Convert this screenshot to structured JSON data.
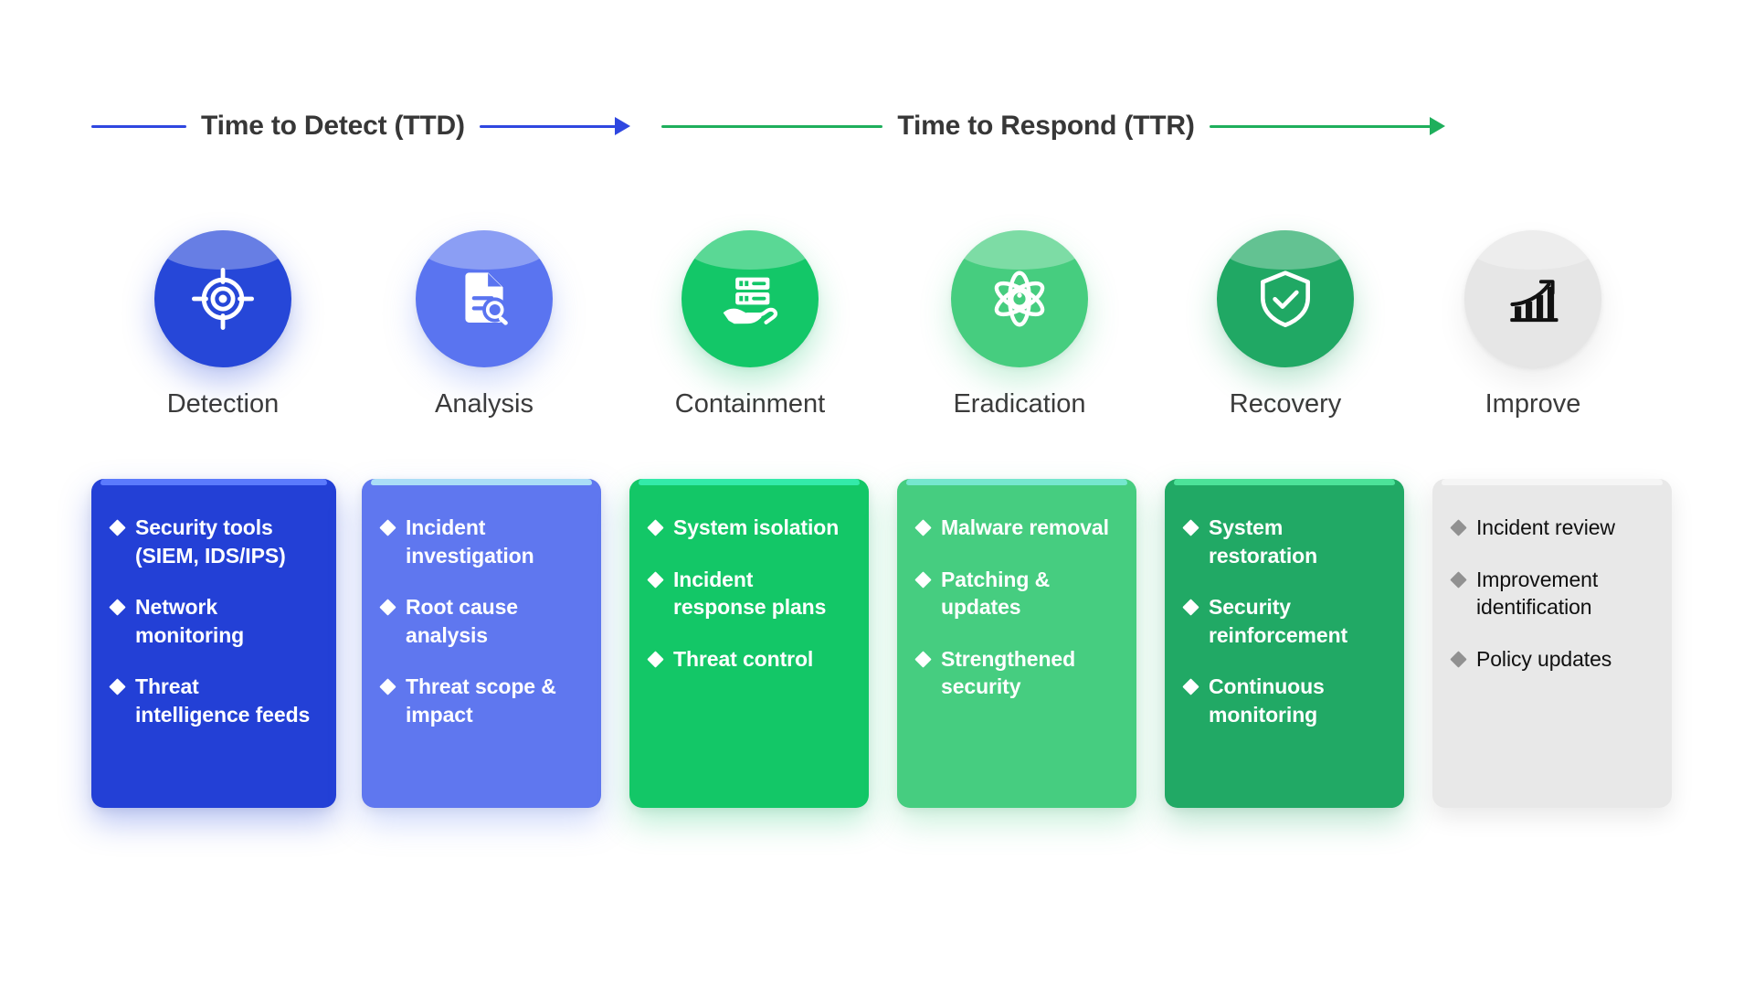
{
  "phases": [
    {
      "id": "ttd",
      "label": "Time to Detect (TTD)",
      "color": "#2f47e0"
    },
    {
      "id": "ttr",
      "label": "Time to Respond (TTR)",
      "color": "#1faf5c"
    }
  ],
  "stages": [
    {
      "key": "detection",
      "label": "Detection",
      "icon": "crosshair-target-icon",
      "circle_color": "#2647d8",
      "card_color": "#2340d6",
      "card_rim": "#5f7dff",
      "bullet_color": "#ffffff",
      "text_color": "#ffffff",
      "glow": "rgba(52,86,224,0.34)",
      "items": [
        "Security tools (SIEM, IDS/IPS)",
        "Network monitoring",
        "Threat intelligence feeds"
      ]
    },
    {
      "key": "analysis",
      "label": "Analysis",
      "icon": "document-search-icon",
      "circle_color": "#5a74f0",
      "card_color": "#5f77ef",
      "card_rim": "#aee3f7",
      "bullet_color": "#ffffff",
      "text_color": "#ffffff",
      "glow": "rgba(118,146,243,0.34)",
      "items": [
        "Incident investigation",
        "Root cause analysis",
        "Threat scope & impact"
      ]
    },
    {
      "key": "containment",
      "label": "Containment",
      "icon": "hand-server-icon",
      "circle_color": "#13c768",
      "card_color": "#13c767",
      "card_rim": "#35ecae",
      "bullet_color": "#ffffff",
      "text_color": "#ffffff",
      "glow": "rgba(30,200,115,0.30)",
      "items": [
        "System isolation",
        "Incident response plans",
        "Threat control"
      ]
    },
    {
      "key": "eradication",
      "label": "Eradication",
      "icon": "atom-icon",
      "circle_color": "#46cd7f",
      "card_color": "#46cd80",
      "card_rim": "#78e8d2",
      "bullet_color": "#ffffff",
      "text_color": "#ffffff",
      "glow": "rgba(80,210,140,0.30)",
      "items": [
        "Malware removal",
        "Patching & updates",
        "Strengthened security"
      ]
    },
    {
      "key": "recovery",
      "label": "Recovery",
      "icon": "shield-check-icon",
      "circle_color": "#20a864",
      "card_color": "#21a965",
      "card_rim": "#4fe59c",
      "bullet_color": "#ffffff",
      "text_color": "#ffffff",
      "glow": "rgba(40,175,110,0.30)",
      "items": [
        "System restoration",
        "Security reinforcement",
        "Continuous monitoring"
      ]
    },
    {
      "key": "improve",
      "label": "Improve",
      "icon": "growth-chart-icon",
      "circle_color": "#e6e6e6",
      "card_color": "#e8e8e8",
      "card_rim": "#f6f6f6",
      "bullet_color": "#919191",
      "text_color": "#101010",
      "glow": "rgba(0,0,0,0.07)",
      "items": [
        "Incident review",
        "Improvement identification",
        "Policy updates"
      ]
    }
  ]
}
